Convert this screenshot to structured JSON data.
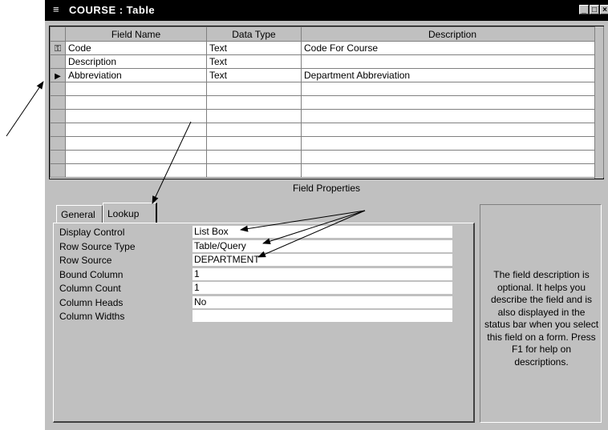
{
  "window": {
    "title": "COURSE : Table",
    "minimize": "_",
    "restore": "□",
    "close": "×"
  },
  "grid": {
    "columns": [
      "Field Name",
      "Data Type",
      "Description"
    ],
    "rows": [
      {
        "selector": "key-icon",
        "field": "Code",
        "type": "Text",
        "desc": "Code For Course"
      },
      {
        "selector": "",
        "field": "Description",
        "type": "Text",
        "desc": ""
      },
      {
        "selector": "current-row-icon",
        "field": "Abbreviation",
        "type": "Text",
        "desc": "Department Abbreviation"
      }
    ],
    "empty_row_count": 7
  },
  "field_properties": {
    "label": "Field Properties",
    "tabs": [
      "General",
      "Lookup"
    ],
    "active_tab": "Lookup",
    "properties": [
      {
        "label": "Display Control",
        "value": "List Box"
      },
      {
        "label": "Row Source Type",
        "value": "Table/Query"
      },
      {
        "label": "Row Source",
        "value": "DEPARTMENT"
      },
      {
        "label": "Bound Column",
        "value": "1"
      },
      {
        "label": "Column Count",
        "value": "1"
      },
      {
        "label": "Column Heads",
        "value": "No"
      },
      {
        "label": "Column Widths",
        "value": ""
      }
    ]
  },
  "help_text": "The field description is optional.  It helps you describe the field and is also displayed in the status bar when you select this field on a form.  Press F1 for help on descriptions."
}
